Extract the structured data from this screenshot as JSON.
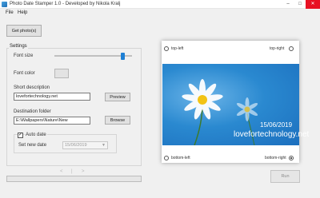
{
  "window": {
    "title": "Photo Date Stamper 1.0 - Developed by Nikola Kralj",
    "minimize_icon": "minimize-icon",
    "maximize_icon": "maximize-icon",
    "close_icon": "close-icon",
    "close_color": "#e81123",
    "min_glyph": "–",
    "max_glyph": "□",
    "close_glyph": "✕"
  },
  "menu": {
    "items": [
      {
        "label": "File"
      },
      {
        "label": "Help"
      }
    ]
  },
  "toolbar": {
    "get_photo_label": "Get photo(s)"
  },
  "settings": {
    "legend": "Settings",
    "font_size_label": "Font size",
    "font_size_level": 0.88,
    "font_color_label": "Font color",
    "font_color_value": "#e3e3e3",
    "short_description_label": "Short description",
    "short_description_value": "lovefortechnology.net",
    "preview_label": "Preview",
    "destination_folder_label": "Destination folder",
    "destination_folder_value": "E:\\Wallpapers\\Nature\\New",
    "browse_label": "Browse",
    "auto_date_label": "Auto date",
    "auto_date_checked": true,
    "set_new_date_label": "Set new date",
    "set_new_date_value": "15/06/2019"
  },
  "pager": {
    "prev": "<",
    "separator": "|",
    "next": ">"
  },
  "progress": {
    "value": 0
  },
  "preview": {
    "date_stamp": "15/06/2019",
    "description_stamp": "lovefortechnology.net",
    "positions": {
      "top_left": "top-left",
      "top_right": "top-right",
      "bottom_left": "bottom-left",
      "bottom_right": "bottom-right",
      "selected": "bottom-right"
    },
    "sky_color": "#2a89d0"
  },
  "actions": {
    "run_label": "Run"
  },
  "colors": {
    "accent": "#1e7fd4",
    "face": "#f0f0f0"
  }
}
